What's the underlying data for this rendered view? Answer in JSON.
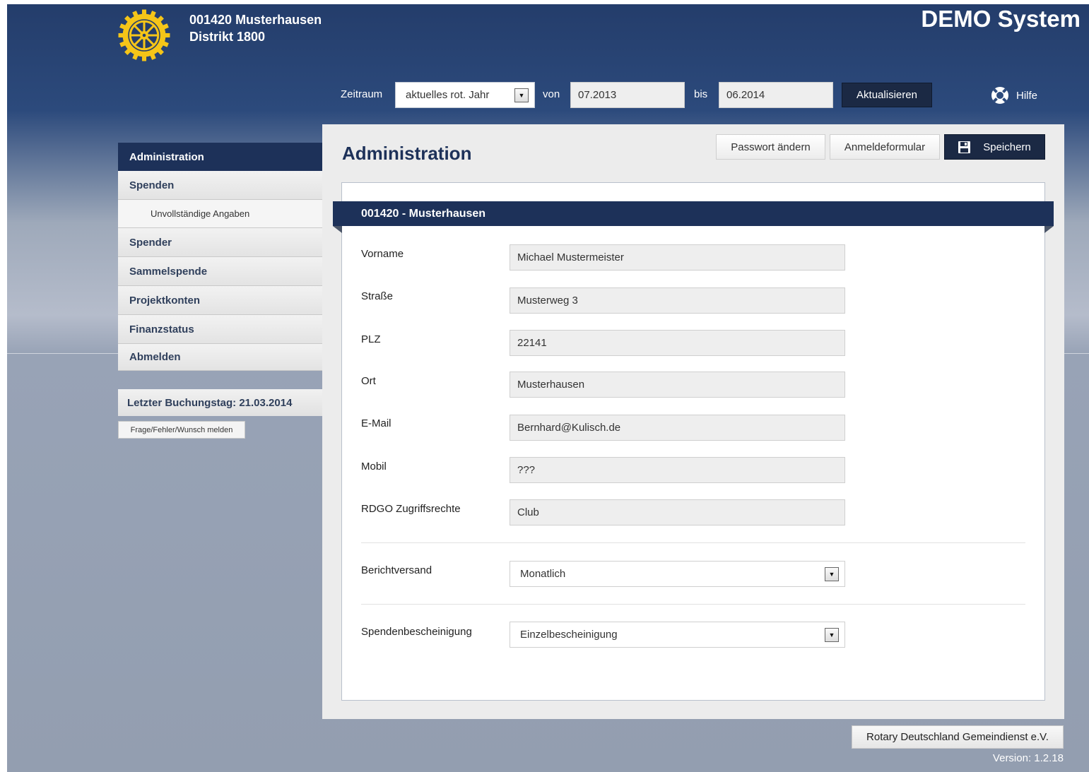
{
  "header": {
    "club_name": "001420 Musterhausen",
    "district": "Distrikt 1800",
    "system_title": "DEMO System"
  },
  "toolbar": {
    "period_label": "Zeitraum",
    "period_value": "aktuelles rot. Jahr",
    "from_label": "von",
    "from_value": "07.2013",
    "to_label": "bis",
    "to_value": "06.2014",
    "refresh_label": "Aktualisieren",
    "help_label": "Hilfe"
  },
  "sidebar": {
    "header": "Administration",
    "items": [
      {
        "label": "Spenden",
        "type": "item"
      },
      {
        "label": "Unvollständige Angaben",
        "type": "sub"
      },
      {
        "label": "Spender",
        "type": "item"
      },
      {
        "label": "Sammelspende",
        "type": "item"
      },
      {
        "label": "Projektkonten",
        "type": "item"
      },
      {
        "label": "Finanzstatus",
        "type": "item"
      },
      {
        "label": "Abmelden",
        "type": "item"
      }
    ],
    "last_booking": "Letzter Buchungstag: 21.03.2014",
    "report_button": "Frage/Fehler/Wunsch melden"
  },
  "main": {
    "title": "Administration",
    "buttons": {
      "change_password": "Passwort ändern",
      "registration_form": "Anmeldeformular",
      "save": "Speichern"
    },
    "section_title": "001420 - Musterhausen",
    "fields": [
      {
        "label": "Vorname",
        "value": "Michael Mustermeister"
      },
      {
        "label": "Straße",
        "value": "Musterweg 3"
      },
      {
        "label": "PLZ",
        "value": "22141"
      },
      {
        "label": "Ort",
        "value": "Musterhausen"
      },
      {
        "label": "E-Mail",
        "value": "Bernhard@Kulisch.de"
      },
      {
        "label": "Mobil",
        "value": "???"
      },
      {
        "label": "RDGO Zugriffsrechte",
        "value": "Club"
      }
    ],
    "report_delivery": {
      "label": "Berichtversand",
      "value": "Monatlich"
    },
    "donation_receipt": {
      "label": "Spendenbescheinigung",
      "value": "Einzelbescheinigung"
    }
  },
  "footer": {
    "organization": "Rotary Deutschland Gemeindienst e.V.",
    "version": "Version: 1.2.18"
  },
  "colors": {
    "header_navy": "#243d6b",
    "accent_navy": "#1d3159",
    "button_dark": "#1b2944",
    "rotary_gold": "#f5c518"
  }
}
